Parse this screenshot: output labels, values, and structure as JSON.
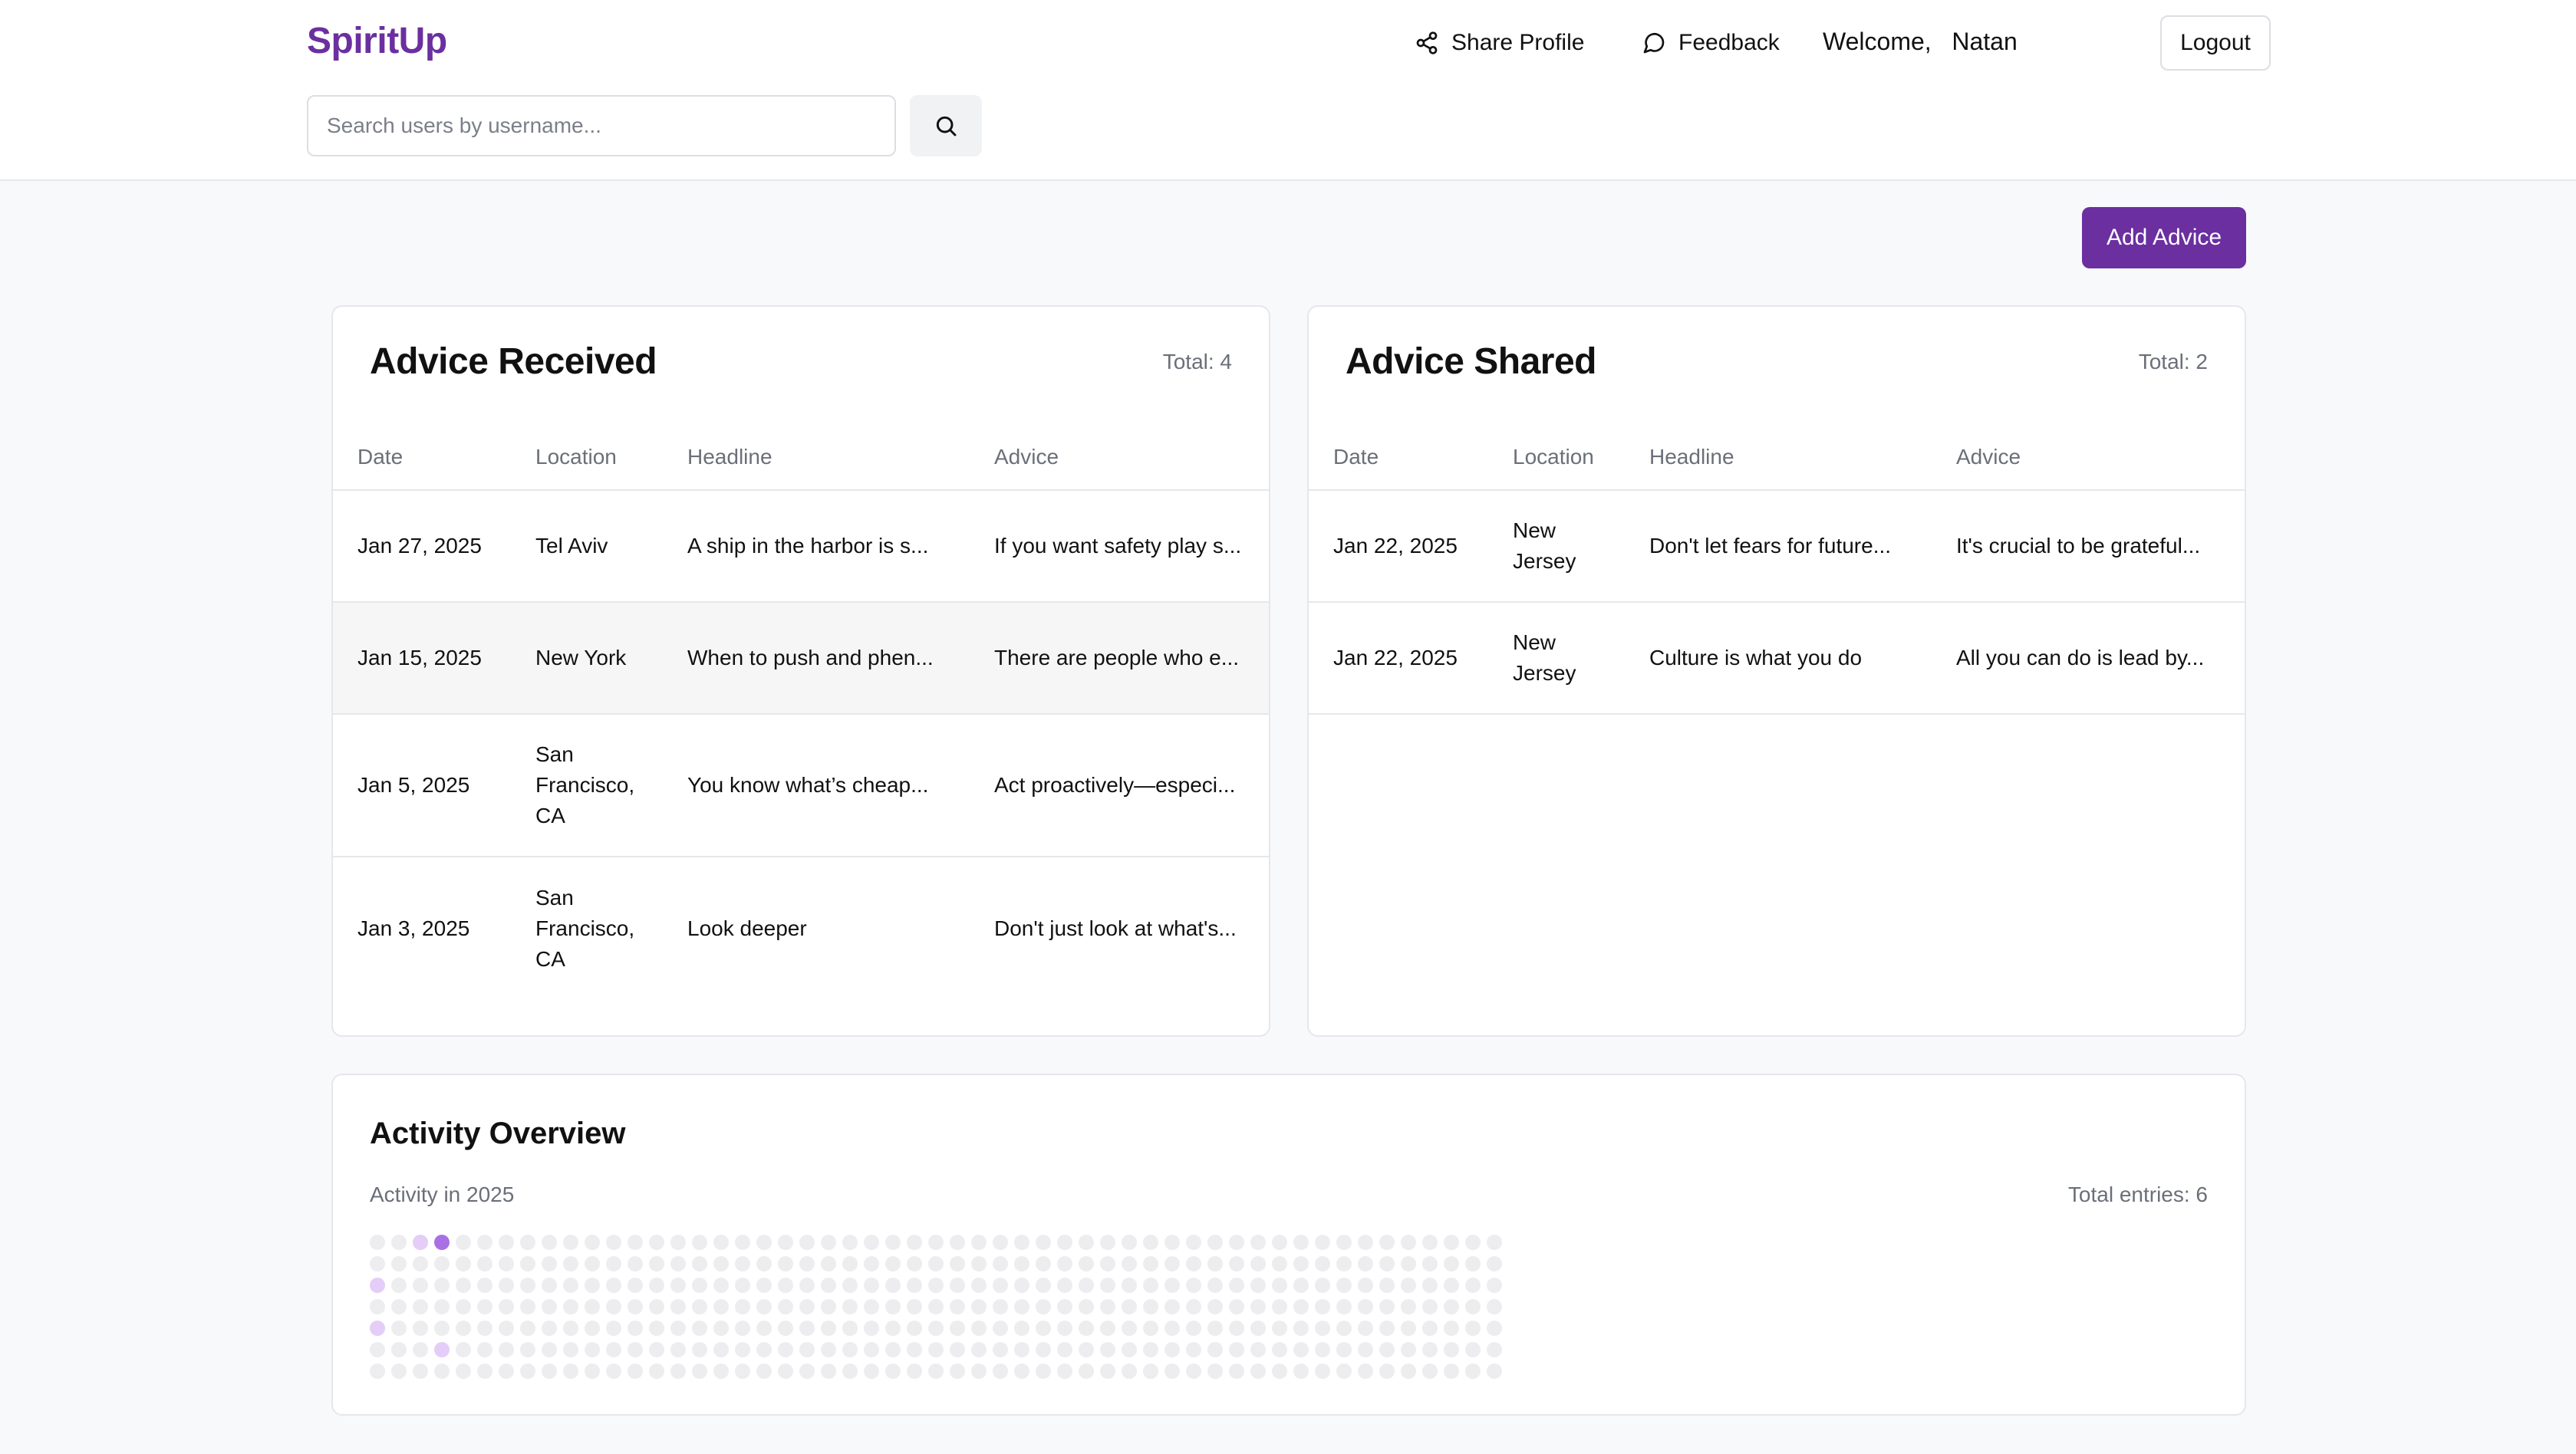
{
  "header": {
    "brand": "SpiritUp",
    "share_label": "Share Profile",
    "feedback_label": "Feedback",
    "welcome_prefix": "Welcome,",
    "user_name": "Natan",
    "logout_label": "Logout"
  },
  "search": {
    "placeholder": "Search users by username..."
  },
  "add_advice_label": "Add Advice",
  "received": {
    "title": "Advice Received",
    "total": "Total: 4",
    "columns": [
      "Date",
      "Location",
      "Headline",
      "Advice"
    ],
    "rows": [
      {
        "date": "Jan 27, 2025",
        "location": "Tel Aviv",
        "headline": "A ship in the harbor is s...",
        "advice": "If you want safety play s..."
      },
      {
        "date": "Jan 15, 2025",
        "location": "New York",
        "headline": "When to push and phen...",
        "advice": "There are people who e..."
      },
      {
        "date": "Jan 5, 2025",
        "location": "San Francisco, CA",
        "headline": "You know what’s cheap...",
        "advice": "Act proactively—especi..."
      },
      {
        "date": "Jan 3, 2025",
        "location": "San Francisco, CA",
        "headline": "Look deeper",
        "advice": "Don't just look at what's..."
      }
    ]
  },
  "shared": {
    "title": "Advice Shared",
    "total": "Total: 2",
    "columns": [
      "Date",
      "Location",
      "Headline",
      "Advice"
    ],
    "rows": [
      {
        "date": "Jan 22, 2025",
        "location": "New Jersey",
        "headline": "Don't let fears for future...",
        "advice": "It's crucial to be grateful..."
      },
      {
        "date": "Jan 22, 2025",
        "location": "New Jersey",
        "headline": "Culture is what you do",
        "advice": "All you can do is lead by..."
      }
    ]
  },
  "activity": {
    "title": "Activity Overview",
    "subtitle": "Activity in 2025",
    "total": "Total entries: 6",
    "weeks": 53,
    "days_per_week": 7,
    "colors": {
      "empty": "#ededf0",
      "level1": "#e4cdf7",
      "level2": "#a970e6"
    },
    "active_cells": [
      {
        "week": 2,
        "day": 0,
        "level": 1
      },
      {
        "week": 3,
        "day": 0,
        "level": 2
      },
      {
        "week": 0,
        "day": 2,
        "level": 1
      },
      {
        "week": 0,
        "day": 4,
        "level": 1
      },
      {
        "week": 3,
        "day": 5,
        "level": 1
      }
    ]
  },
  "colors": {
    "brand": "#6b2fa0",
    "accent_button": "#6b2fa0"
  },
  "icons": {
    "share": "share-icon",
    "feedback": "message-circle-icon",
    "search": "search-icon"
  }
}
